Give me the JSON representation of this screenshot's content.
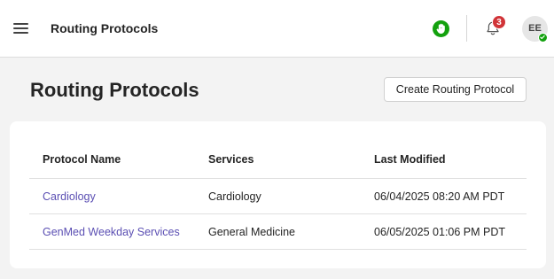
{
  "header": {
    "app_title": "Routing Protocols",
    "notification_count": "3",
    "avatar_initials": "EE",
    "presence_color": "#13a10e"
  },
  "page": {
    "title": "Routing Protocols",
    "create_button_label": "Create Routing Protocol"
  },
  "table": {
    "columns": [
      "Protocol Name",
      "Services",
      "Last Modified"
    ],
    "rows": [
      {
        "name": "Cardiology",
        "services": "Cardiology",
        "modified": "06/04/2025 08:20 AM PDT"
      },
      {
        "name": "GenMed Weekday Services",
        "services": "General Medicine",
        "modified": "06/05/2025 01:06 PM PDT"
      }
    ]
  },
  "colors": {
    "link": "#5b4fb3",
    "badge": "#d13438",
    "status_available": "#13a10e"
  },
  "icons": [
    "menu-icon",
    "hand-icon",
    "bell-icon",
    "checkmark-icon"
  ]
}
